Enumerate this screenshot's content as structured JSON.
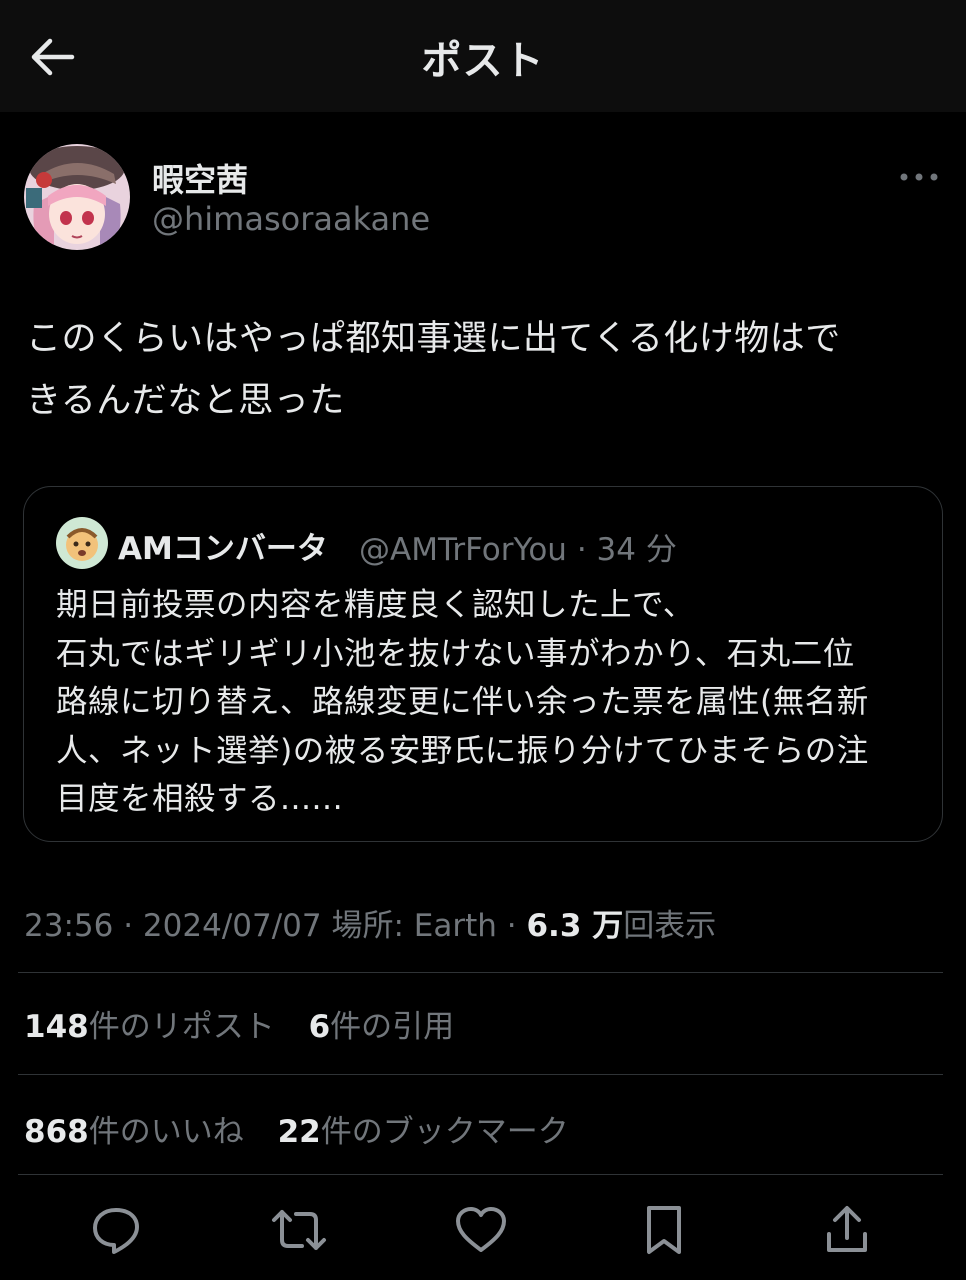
{
  "header": {
    "title": "ポスト",
    "back_icon": "back-arrow-icon"
  },
  "author": {
    "name": "暇空茜",
    "handle": "@himasoraakane"
  },
  "tweet": {
    "lines": [
      "このくらいはやっぱ都知事選に出てくる化け物はで",
      "きるんだなと思った"
    ]
  },
  "quote": {
    "name": "AMコンバータ",
    "handle": "@AMTrForYou",
    "separator": "·",
    "time": "34 分",
    "lines": [
      "期日前投票の内容を精度良く認知した上で、",
      "石丸ではギリギリ小池を抜けない事がわかり、石丸二位",
      "路線に切り替え、路線変更に伴い余った票を属性(無名新",
      "人、ネット選挙)の被る安野氏に振り分けてひまそらの注",
      "目度を相殺する......"
    ]
  },
  "meta": {
    "time": "23:56",
    "sep1": "·",
    "date": "2024/07/07",
    "location": "場所: Earth",
    "sep2": "·",
    "views_count": "6.3 万",
    "views_label": "回表示"
  },
  "stats": {
    "reposts_count": "148",
    "reposts_label": "件のリポスト",
    "quotes_count": "6",
    "quotes_label": "件の引用",
    "likes_count": "868",
    "likes_label": "件のいいね",
    "bookmarks_count": "22",
    "bookmarks_label": "件のブックマーク"
  },
  "actions": [
    "reply-icon",
    "repost-icon",
    "like-icon",
    "bookmark-icon",
    "share-icon"
  ],
  "colors": {
    "background": "#000000",
    "header_bg": "#0d0d0d",
    "text": "#e7e9ea",
    "secondary": "#71767b",
    "border": "#2f3336"
  }
}
